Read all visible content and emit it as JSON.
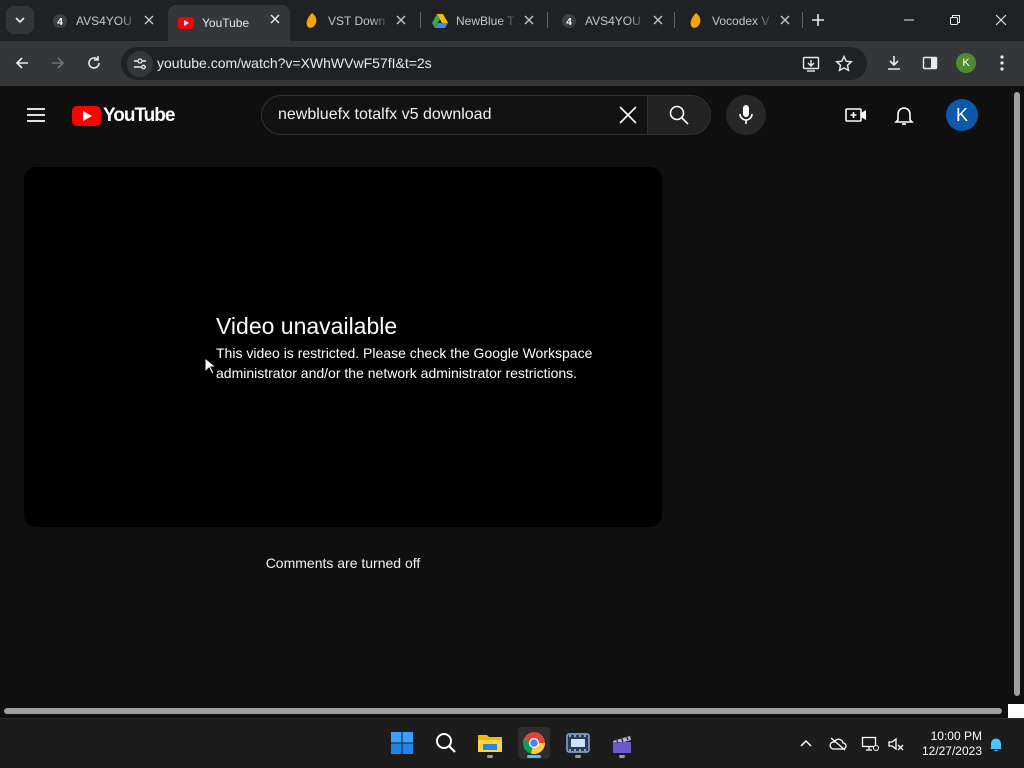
{
  "browser": {
    "tabs": [
      {
        "favicon": "avs4you-icon",
        "title": "AVS4YOU ",
        "active": false
      },
      {
        "favicon": "youtube-icon",
        "title": "YouTube",
        "active": true
      },
      {
        "favicon": "fl-studio-icon",
        "title": "VST Down",
        "active": false
      },
      {
        "favicon": "google-drive-icon",
        "title": "NewBlue T",
        "active": false
      },
      {
        "favicon": "avs4you-icon",
        "title": "AVS4YOU",
        "active": false
      },
      {
        "favicon": "fl-studio-icon",
        "title": "Vocodex V",
        "active": false
      }
    ],
    "url": "youtube.com/watch?v=XWhWVwF57fI&t=2s",
    "profile_initial": "K"
  },
  "youtube": {
    "logo_text": "YouTube",
    "search_value": "newbluefx totalfx v5 download",
    "avatar_initial": "K",
    "player": {
      "error_title": "Video unavailable",
      "error_message": "This video is restricted. Please check the Google Workspace administrator and/or the network administrator restrictions."
    },
    "comments_status": "Comments are turned off"
  },
  "taskbar": {
    "apps": [
      "windows-start-icon",
      "search-icon",
      "file-explorer-icon",
      "chrome-icon",
      "video-editor-icon",
      "clapperboard-icon"
    ],
    "time": "10:00 PM",
    "date": "12/27/2023"
  },
  "colors": {
    "youtube_red": "#ff0000",
    "page_bg": "#0f0f0f",
    "taskbar_accent": "#4cc2ff"
  }
}
